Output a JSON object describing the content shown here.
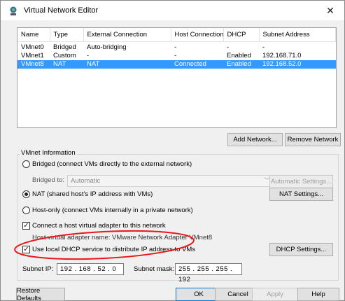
{
  "window": {
    "title": "Virtual Network Editor",
    "close_glyph": "✕",
    "icon": "vmware-network-icon"
  },
  "table": {
    "columns": [
      "Name",
      "Type",
      "External Connection",
      "Host Connection",
      "DHCP",
      "Subnet Address"
    ],
    "rows": [
      {
        "name": "VMnet0",
        "type": "Bridged",
        "external": "Auto-bridging",
        "host": "-",
        "dhcp": "-",
        "subnet": "-"
      },
      {
        "name": "VMnet1",
        "type": "Custom",
        "external": "-",
        "host": "-",
        "dhcp": "Enabled",
        "subnet": "192.168.71.0"
      },
      {
        "name": "VMnet8",
        "type": "NAT",
        "external": "NAT",
        "host": "Connected",
        "dhcp": "Enabled",
        "subnet": "192.168.52.0"
      }
    ],
    "selected_row": 2
  },
  "table_buttons": {
    "add_network": "Add Network...",
    "remove_network": "Remove Network"
  },
  "vmnet_info": {
    "group_label": "VMnet Information",
    "bridged_label": "Bridged (connect VMs directly to the external network)",
    "bridged_to_label": "Bridged to:",
    "bridged_to_value": "Automatic",
    "automatic_settings": "Automatic Settings...",
    "nat_label": "NAT (shared host's IP address with VMs)",
    "nat_settings": "NAT Settings...",
    "host_only_label": "Host-only (connect VMs internally in a private network)",
    "connect_adapter_label": "Connect a host virtual adapter to this network",
    "adapter_name_label": "Host virtual adapter name: VMware Network Adapter VMnet8",
    "dhcp_label": "Use local DHCP service to distribute IP address to VMs",
    "dhcp_settings": "DHCP Settings...",
    "subnet_ip_label": "Subnet IP:",
    "subnet_ip_value": "192 . 168 . 52 . 0",
    "subnet_mask_label": "Subnet mask:",
    "subnet_mask_value": "255 . 255 . 255 . 192",
    "selected_mode": "nat",
    "connect_adapter_checked": true,
    "dhcp_checked": true
  },
  "footer": {
    "restore_defaults": "Restore Defaults",
    "ok": "OK",
    "cancel": "Cancel",
    "apply": "Apply",
    "help": "Help"
  },
  "colors": {
    "selection": "#3399ff",
    "annotation": "#e8181c"
  }
}
